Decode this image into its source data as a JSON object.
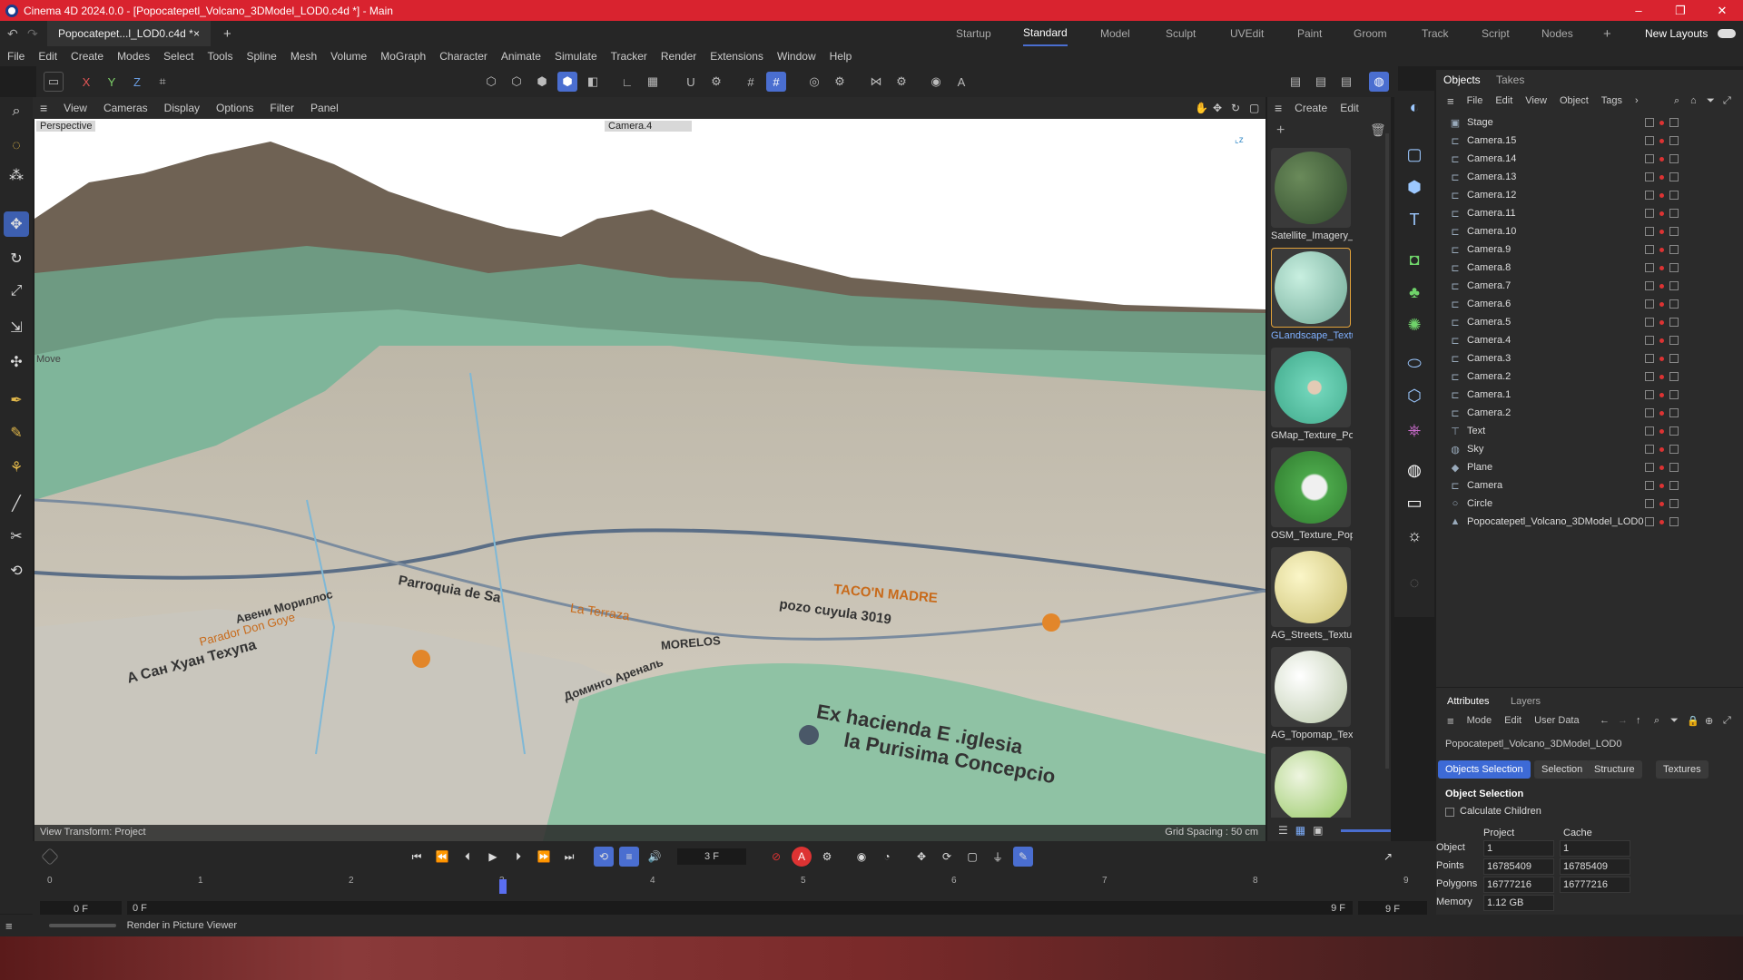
{
  "window": {
    "title": "Cinema 4D 2024.0.0 - [Popocatepetl_Volcano_3DModel_LOD0.c4d *] - Main",
    "controls": [
      "–",
      "❐",
      "✕"
    ]
  },
  "tabs": {
    "document": "Popocatepet...l_LOD0.c4d *",
    "close": "×",
    "add": "+"
  },
  "layouts": {
    "items": [
      "Startup",
      "Standard",
      "Model",
      "Sculpt",
      "UVEdit",
      "Paint",
      "Groom",
      "Track",
      "Script",
      "Nodes"
    ],
    "active": "Standard",
    "new_layouts": "New Layouts"
  },
  "menu": [
    "File",
    "Edit",
    "Create",
    "Modes",
    "Select",
    "Tools",
    "Spline",
    "Mesh",
    "Volume",
    "MoGraph",
    "Character",
    "Animate",
    "Simulate",
    "Tracker",
    "Render",
    "Extensions",
    "Window",
    "Help"
  ],
  "axis_buttons": [
    "X",
    "Y",
    "Z"
  ],
  "viewport": {
    "menu": [
      "View",
      "Cameras",
      "Display",
      "Options",
      "Filter",
      "Panel"
    ],
    "projection": "Perspective",
    "camera": "Camera.4",
    "tool_label": "Move",
    "view_transform": "View Transform: Project",
    "grid_spacing": "Grid Spacing : 50 cm",
    "map_labels": [
      "Ex hacienda E .iglesia",
      "la Purisima Concepcio",
      "A Сан Хуан Техупа",
      "Parroquia de Sa",
      "pozo cuyula 3019",
      "TACO'N MADRE",
      "La Terraza",
      "MORELOS",
      "Parador Don Goye",
      "Доминго Ареналь",
      "Авени Мориллос"
    ]
  },
  "material_panel": {
    "menu": [
      "Create",
      "Edit"
    ],
    "materials": [
      {
        "name": "Satellite_Imagery_",
        "color": "#2f4a2c"
      },
      {
        "name": "GLandscape_Textu",
        "color": "#8fc9b5",
        "selected": true
      },
      {
        "name": "GMap_Texture_Po",
        "color": "#6fd3b8"
      },
      {
        "name": "OSM_Texture_Pop",
        "color": "#4ba64a"
      },
      {
        "name": "AG_Streets_Textur",
        "color": "#ece29f"
      },
      {
        "name": "AG_Topomap_Tex",
        "color": "#dfe8cf"
      },
      {
        "name": "",
        "color": "#8fc45a"
      }
    ]
  },
  "objects_panel": {
    "tabs": [
      "Objects",
      "Takes"
    ],
    "menu": [
      "File",
      "Edit",
      "View",
      "Object",
      "Tags"
    ],
    "items": [
      {
        "name": "Stage",
        "icon": "stage-icon"
      },
      {
        "name": "Camera.15",
        "icon": "camera-icon"
      },
      {
        "name": "Camera.14",
        "icon": "camera-icon"
      },
      {
        "name": "Camera.13",
        "icon": "camera-icon"
      },
      {
        "name": "Camera.12",
        "icon": "camera-icon"
      },
      {
        "name": "Camera.11",
        "icon": "camera-icon"
      },
      {
        "name": "Camera.10",
        "icon": "camera-icon"
      },
      {
        "name": "Camera.9",
        "icon": "camera-icon"
      },
      {
        "name": "Camera.8",
        "icon": "camera-icon"
      },
      {
        "name": "Camera.7",
        "icon": "camera-icon"
      },
      {
        "name": "Camera.6",
        "icon": "camera-icon"
      },
      {
        "name": "Camera.5",
        "icon": "camera-icon"
      },
      {
        "name": "Camera.4",
        "icon": "camera-icon"
      },
      {
        "name": "Camera.3",
        "icon": "camera-icon"
      },
      {
        "name": "Camera.2",
        "icon": "camera-icon"
      },
      {
        "name": "Camera.1",
        "icon": "camera-icon"
      },
      {
        "name": "Camera.2",
        "icon": "camera-icon"
      },
      {
        "name": "Text",
        "icon": "text-icon"
      },
      {
        "name": "Sky",
        "icon": "sky-icon"
      },
      {
        "name": "Plane",
        "icon": "plane-icon"
      },
      {
        "name": "Camera",
        "icon": "camera-icon"
      },
      {
        "name": "Circle",
        "icon": "circle-icon"
      },
      {
        "name": "Popocatepetl_Volcano_3DModel_LOD0",
        "icon": "polygon-object-icon"
      }
    ]
  },
  "attributes_panel": {
    "tabs": [
      "Attributes",
      "Layers"
    ],
    "menu": [
      "Mode",
      "Edit",
      "User Data"
    ],
    "object_name": "Popocatepetl_Volcano_3DModel_LOD0",
    "filter_tabs": [
      "Objects Selection",
      "Selection",
      "Structure",
      "Textures"
    ],
    "section": "Object Selection",
    "calculate_children": "Calculate Children",
    "col_project": "Project",
    "col_cache": "Cache",
    "rows": [
      {
        "label": "Object",
        "project": "1",
        "cache": "1"
      },
      {
        "label": "Points",
        "project": "16785409",
        "cache": "16785409"
      },
      {
        "label": "Polygons",
        "project": "16777216",
        "cache": "16777216"
      },
      {
        "label": "Memory",
        "project": "1.12 GB",
        "cache": ""
      }
    ]
  },
  "timeline": {
    "current_frame": "3 F",
    "ticks": [
      "0",
      "1",
      "2",
      "3",
      "4",
      "5",
      "6",
      "7",
      "8",
      "9"
    ],
    "start": "0 F",
    "start2": "0 F",
    "end": "9 F",
    "end2": "9 F",
    "current_pos": 0.333
  },
  "status": {
    "text": "Render in Picture Viewer"
  },
  "colors": {
    "title_bg": "#d9232f",
    "accent": "#4a6ed0",
    "panel_bg": "#2b2b2b"
  }
}
